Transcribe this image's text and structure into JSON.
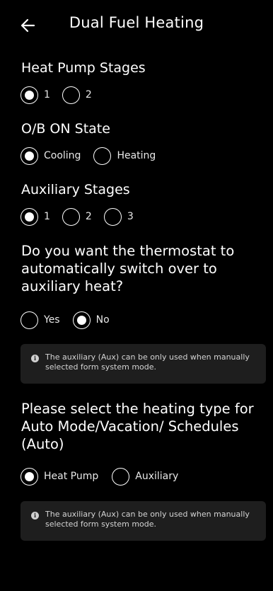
{
  "header": {
    "back_icon": "arrow-left-icon",
    "title": "Dual Fuel Heating"
  },
  "heat_pump_stages": {
    "title": "Heat Pump Stages",
    "options": [
      "1",
      "2"
    ],
    "selected": "1"
  },
  "ob_on_state": {
    "title": "O/B ON State",
    "options": [
      "Cooling",
      "Heating"
    ],
    "selected": "Cooling"
  },
  "auxiliary_stages": {
    "title": "Auxiliary Stages",
    "options": [
      "1",
      "2",
      "3"
    ],
    "selected": "1"
  },
  "auto_switch": {
    "question": "Do you want the thermostat to automatically switch over to auxiliary heat?",
    "options": [
      "Yes",
      "No"
    ],
    "selected": "No",
    "info_icon": "info-icon",
    "info_text": "The auxiliary (Aux) can be only used when manually selected form system mode."
  },
  "heating_type": {
    "question": "Please select the heating type for Auto Mode/Vacation/ Schedules (Auto)",
    "options": [
      "Heat Pump",
      "Auxiliary"
    ],
    "selected": "Heat Pump",
    "info_icon": "info-icon",
    "info_text": "The auxiliary (Aux) can be only used when manually selected form system mode."
  }
}
